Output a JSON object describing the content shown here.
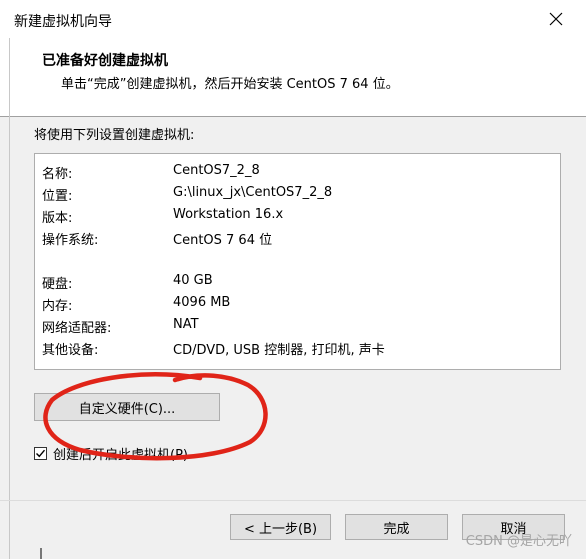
{
  "window": {
    "title": "新建虚拟机向导"
  },
  "header": {
    "title": "已准备好创建虚拟机",
    "description": "单击“完成”创建虚拟机，然后开始安装 CentOS 7 64 位。"
  },
  "intro": "将使用下列设置创建虚拟机:",
  "settings": [
    {
      "label": "名称:",
      "value": "CentOS7_2_8"
    },
    {
      "label": "位置:",
      "value": "G:\\linux_jx\\CentOS7_2_8"
    },
    {
      "label": "版本:",
      "value": "Workstation 16.x"
    },
    {
      "label": "操作系统:",
      "value": "CentOS 7 64 位"
    },
    {
      "label": "硬盘:",
      "value": "40 GB"
    },
    {
      "label": "内存:",
      "value": "4096 MB"
    },
    {
      "label": "网络适配器:",
      "value": "NAT"
    },
    {
      "label": "其他设备:",
      "value": "CD/DVD, USB 控制器, 打印机, 声卡"
    }
  ],
  "buttons": {
    "customize": "自定义硬件(C)...",
    "back": "< 上一步(B)",
    "finish": "完成",
    "cancel": "取消"
  },
  "checkbox": {
    "label": "创建后开启此虚拟机(P)",
    "checked": true
  },
  "annotation_color": "#e02418",
  "watermark": "CSDN @是心无吖"
}
